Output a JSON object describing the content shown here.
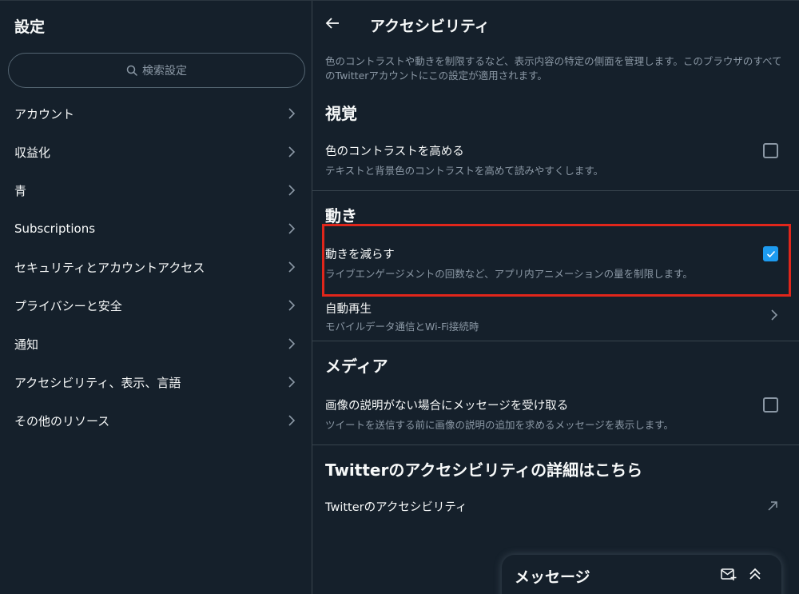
{
  "settings": {
    "title": "設定",
    "search_placeholder": "検索設定",
    "items": [
      {
        "label": "アカウント"
      },
      {
        "label": "収益化"
      },
      {
        "label": "青"
      },
      {
        "label": "Subscriptions"
      },
      {
        "label": "セキュリティとアカウントアクセス"
      },
      {
        "label": "プライバシーと安全"
      },
      {
        "label": "通知"
      },
      {
        "label": "アクセシビリティ、表示、言語"
      },
      {
        "label": "その他のリソース"
      }
    ]
  },
  "accessibility": {
    "title": "アクセシビリティ",
    "description": "色のコントラストや動きを制限するなど、表示内容の特定の側面を管理します。このブラウザのすべてのTwitterアカウントにこの設定が適用されます。",
    "vision": {
      "heading": "視覚",
      "contrast_title": "色のコントラストを高める",
      "contrast_desc": "テキストと背景色のコントラストを高めて読みやすくします。",
      "contrast_checked": false
    },
    "motion": {
      "heading": "動き",
      "reduce_title": "動きを減らす",
      "reduce_desc": "ライブエンゲージメントの回数など、アプリ内アニメーションの量を制限します。",
      "reduce_checked": true,
      "autoplay_title": "自動再生",
      "autoplay_desc": "モバイルデータ通信とWi-Fi接続時"
    },
    "media": {
      "heading": "メディア",
      "alt_title": "画像の説明がない場合にメッセージを受け取る",
      "alt_desc": "ツイートを送信する前に画像の説明の追加を求めるメッセージを表示します。",
      "alt_checked": false
    },
    "more": {
      "heading": "Twitterのアクセシビリティの詳細はこちら",
      "link_label": "Twitterのアクセシビリティ"
    }
  },
  "messages_drawer": {
    "title": "メッセージ"
  },
  "colors": {
    "background": "#15202b",
    "accent": "#1d9bf0",
    "highlight": "#e0261b",
    "muted_text": "#8b98a5"
  }
}
